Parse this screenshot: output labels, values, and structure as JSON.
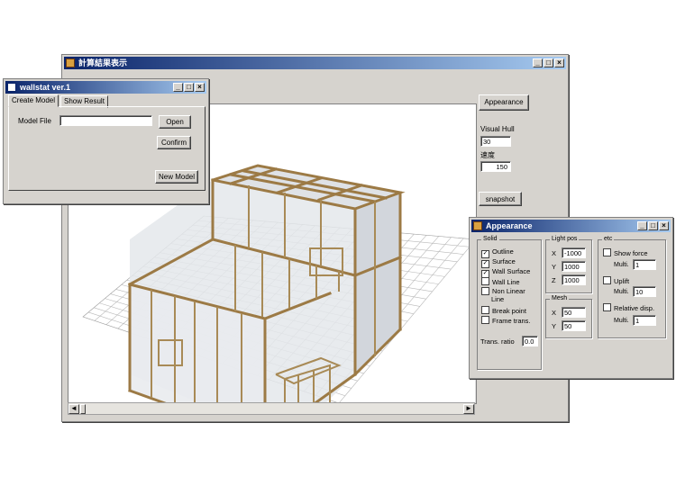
{
  "main_window": {
    "title": "計算結果表示",
    "appearance_button": "Appearance",
    "visual_hull_label": "Visual Hull",
    "visual_hull_value": "30",
    "speed_label": "速度",
    "speed_value": "150",
    "snapshot_button": "snapshot"
  },
  "wallstat_window": {
    "title": "wallstat ver.1",
    "tabs": [
      "Create Model",
      "Show Result"
    ],
    "model_file_label": "Model File",
    "model_file_value": "",
    "open_button": "Open",
    "confirm_button": "Confirm",
    "new_model_button": "New Model"
  },
  "appearance_window": {
    "title": "Appearance",
    "solid": {
      "title": "Solid",
      "items": [
        {
          "label": "Outline",
          "checked": true
        },
        {
          "label": "Surface",
          "checked": true
        },
        {
          "label": "Wall Surface",
          "checked": true
        },
        {
          "label": "Wall Line",
          "checked": false
        },
        {
          "label": "Non Linear Line",
          "checked": false
        },
        {
          "label": "Break point",
          "checked": false
        },
        {
          "label": "Frame trans.",
          "checked": false
        }
      ],
      "trans_ratio_label": "Trans. ratio",
      "trans_ratio_value": "0.0"
    },
    "light_pos": {
      "title": "Light pos",
      "x_label": "X",
      "x_value": "-1000",
      "y_label": "Y",
      "y_value": "1000",
      "z_label": "Z",
      "z_value": "1000"
    },
    "mesh": {
      "title": "Mesh",
      "x_label": "X",
      "x_value": "50",
      "y_label": "Y",
      "y_value": "50"
    },
    "etc": {
      "title": "etc",
      "show_force": "Show force",
      "show_force_checked": false,
      "show_force_mult_label": "Multi.",
      "show_force_mult_value": "1",
      "uplift": "Uplift",
      "uplift_checked": false,
      "uplift_mult_label": "Multi.",
      "uplift_mult_value": "10",
      "relative_disp": "Relative disp.",
      "relative_disp_checked": false,
      "relative_mult_label": "Multi.",
      "relative_mult_value": "1"
    }
  },
  "icons": [
    "app-icon",
    "minimize-icon",
    "maximize-icon",
    "close-icon",
    "scroll-left-icon",
    "scroll-right-icon"
  ],
  "colors": {
    "titlebar": "#0a246a",
    "window_bg": "#d6d3ce",
    "frame_wood": "#c9b89a",
    "wall_glass": "#d9dde3"
  }
}
